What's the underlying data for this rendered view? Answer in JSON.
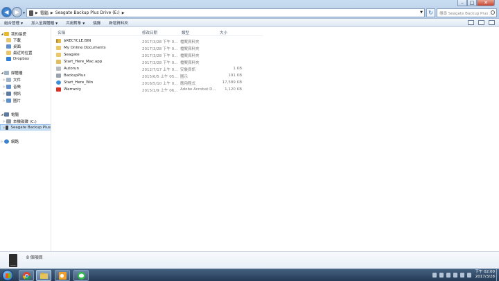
{
  "window": {
    "breadcrumb": [
      "電腦",
      "Seagate Backup Plus Drive (E:)"
    ],
    "search_placeholder": "搜尋 Seagate Backup Plus ..."
  },
  "toolbar": {
    "organize": "組合管理",
    "include_library": "加入至媒體櫃",
    "share_with": "共用對象",
    "burn": "燒錄",
    "new_folder": "新增資料夾"
  },
  "sidebar": {
    "favorites": {
      "label": "我的最愛",
      "items": [
        "下載",
        "桌面",
        "最近的位置",
        "Dropbox"
      ]
    },
    "libraries": {
      "label": "媒體櫃",
      "items": [
        "文件",
        "音樂",
        "視訊",
        "圖片"
      ]
    },
    "computer": {
      "label": "電腦",
      "items": [
        "本機磁碟 (C:)",
        "Seagate Backup Plus"
      ]
    },
    "network": {
      "label": "網路"
    }
  },
  "columns": {
    "name": "名稱",
    "date": "修改日期",
    "type": "類型",
    "size": "大小"
  },
  "files": [
    {
      "name": "$RECYCLE.BIN",
      "date": "2017/3/28 下午 0...",
      "type": "檔案資料夾",
      "size": "",
      "icon": "folder-lock-icon"
    },
    {
      "name": "My Online Documents",
      "date": "2017/3/28 下午 0...",
      "type": "檔案資料夾",
      "size": "",
      "icon": "folder-icon"
    },
    {
      "name": "Seagate",
      "date": "2017/3/28 下午 0...",
      "type": "檔案資料夾",
      "size": "",
      "icon": "folder-icon"
    },
    {
      "name": "Start_Here_Mac.app",
      "date": "2017/3/28 下午 0...",
      "type": "檔案資料夾",
      "size": "",
      "icon": "app-folder-icon"
    },
    {
      "name": "Autorun",
      "date": "2012/7/17 上午 0...",
      "type": "安裝資訊",
      "size": "1 KB",
      "icon": "inf-file-icon"
    },
    {
      "name": "BackupPlus",
      "date": "2015/6/5 上午 05...",
      "type": "圖示",
      "size": "191 KB",
      "icon": "icon-file-icon"
    },
    {
      "name": "Start_Here_Win",
      "date": "2016/5/10 上午 0...",
      "type": "應用程式",
      "size": "17,589 KB",
      "icon": "app-icon"
    },
    {
      "name": "Warranty",
      "date": "2015/1/9 上午 06...",
      "type": "Adobe Acrobat D...",
      "size": "1,120 KB",
      "icon": "pdf-icon"
    }
  ],
  "status": {
    "item_count": "8 個項目"
  },
  "taskbar": {
    "apps": [
      "chrome-icon",
      "explorer-icon",
      "outlook-icon",
      "line-icon"
    ],
    "time": "下午 02:00",
    "date": "2017/3/28"
  }
}
